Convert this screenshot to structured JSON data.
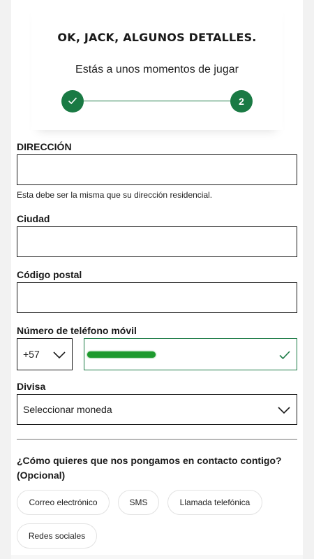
{
  "header": {
    "title": "OK, JACK, ALGUNOS DETALLES.",
    "subtitle": "Estás a unos momentos de jugar",
    "steps": {
      "step1_icon": "check-icon",
      "step2_label": "2"
    }
  },
  "form": {
    "address": {
      "label": "DIRECCIÓN",
      "value": "",
      "hint": "Esta debe ser la misma que su dirección residencial."
    },
    "city": {
      "label": "Ciudad",
      "value": ""
    },
    "postal": {
      "label": "Código postal",
      "value": ""
    },
    "phone": {
      "label": "Número de teléfono móvil",
      "prefix": "+57",
      "value_redacted": true,
      "status_icon": "check-icon"
    },
    "currency": {
      "label": "Divisa",
      "value": "Seleccionar moneda"
    }
  },
  "contact": {
    "question": "¿Cómo quieres que nos pongamos en contacto contigo? (Opcional)",
    "options": [
      "Correo electrónico",
      "SMS",
      "Llamada telefónica",
      "Redes sociales"
    ]
  },
  "colors": {
    "accent": "#1a7a44",
    "redaction": "#1e9a2e"
  }
}
